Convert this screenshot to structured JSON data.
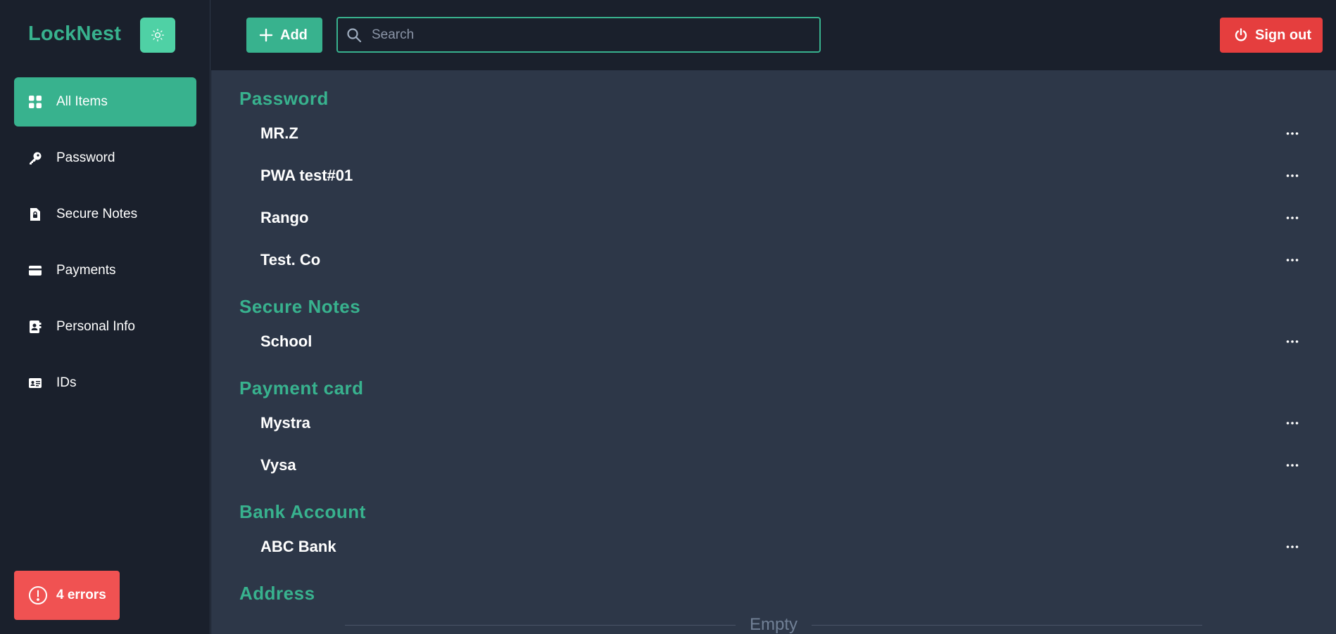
{
  "app": {
    "brand": "LockNest",
    "theme_toggle_icon": "sun-icon"
  },
  "sidebar": {
    "items": [
      {
        "label": "All Items",
        "icon": "grid-icon",
        "active": true
      },
      {
        "label": "Password",
        "icon": "key-icon",
        "active": false
      },
      {
        "label": "Secure Notes",
        "icon": "note-lock-icon",
        "active": false
      },
      {
        "label": "Payments",
        "icon": "credit-card-icon",
        "active": false
      },
      {
        "label": "Personal Info",
        "icon": "contact-book-icon",
        "active": false
      },
      {
        "label": "IDs",
        "icon": "id-card-icon",
        "active": false
      }
    ],
    "errors_badge": "4 errors"
  },
  "topbar": {
    "add_label": "Add",
    "search_placeholder": "Search",
    "search_value": "",
    "signout_label": "Sign out"
  },
  "main": {
    "sections": [
      {
        "title": "Password",
        "items": [
          "MR.Z",
          "PWA test#01",
          "Rango",
          "Test. Co"
        ]
      },
      {
        "title": "Secure Notes",
        "items": [
          "School"
        ]
      },
      {
        "title": "Payment card",
        "items": [
          "Mystra",
          "Vysa"
        ]
      },
      {
        "title": "Bank Account",
        "items": [
          "ABC Bank"
        ]
      },
      {
        "title": "Address",
        "items": []
      }
    ],
    "empty_label": "Empty"
  },
  "colors": {
    "accent": "#38b28e",
    "danger": "#e53e3e",
    "error_badge": "#f05252",
    "sidebar_bg": "#1a202c",
    "content_bg": "#2d3748"
  }
}
